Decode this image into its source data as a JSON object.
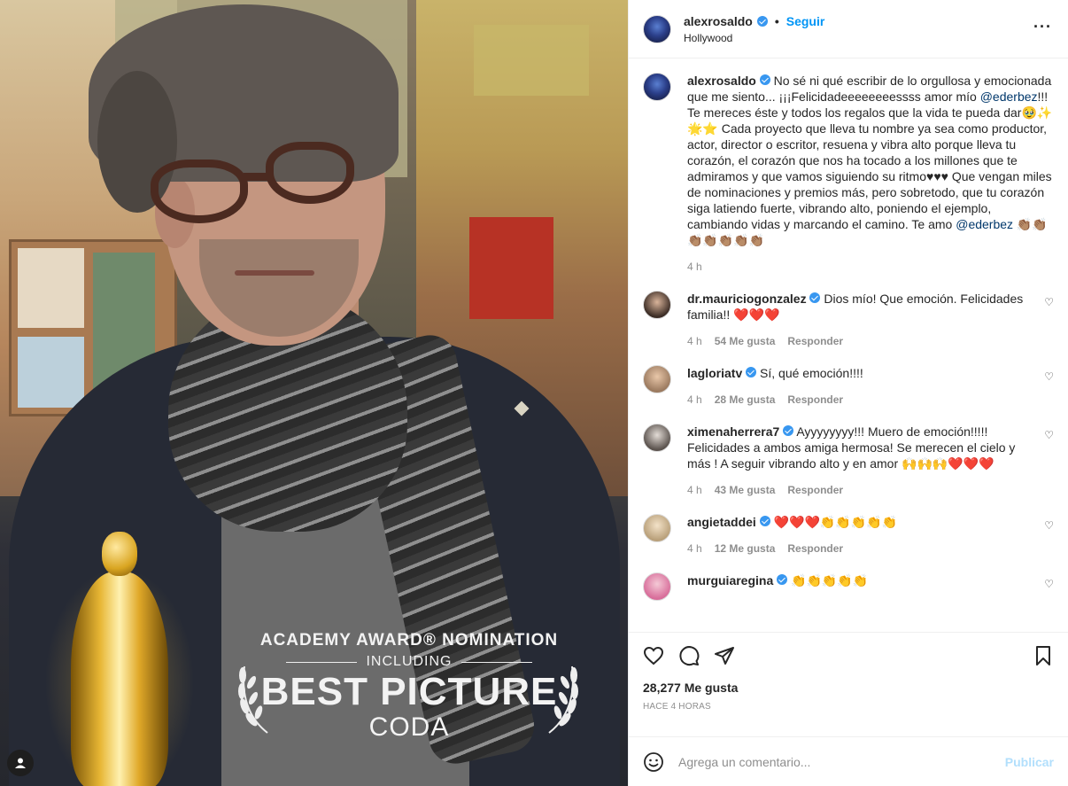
{
  "post": {
    "author": "alexrosaldo",
    "follow_separator": "•",
    "follow_label": "Seguir",
    "location": "Hollywood",
    "more_label": "···"
  },
  "media": {
    "award_line1": "ACADEMY AWARD® NOMINATION",
    "award_line2": "INCLUDING",
    "award_line3": "BEST PICTURE",
    "award_line4": "CODA"
  },
  "caption": {
    "username": "alexrosaldo",
    "text_part1": "No sé ni qué escribir de lo orgullosa y emocionada que me siento... ¡¡¡Felicidadeeeeeeeessss amor mío ",
    "mention1": "@ederbez",
    "text_part2": "!!! Te mereces éste y todos los regalos que la vida te pueda dar🥹✨🌟⭐ Cada proyecto que lleva tu nombre ya sea como productor, actor, director o escritor, resuena y vibra alto porque lleva tu corazón, el corazón que nos ha tocado a los millones que te admiramos y que vamos siguiendo su ritmo♥♥♥ Que vengan miles de nominaciones y premios más, pero sobretodo, que tu corazón siga latiendo fuerte, vibrando alto, poniendo el ejemplo, cambiando vidas y marcando el camino. Te amo ",
    "mention2": "@ederbez",
    "text_part3": " 👏🏽👏🏽👏🏽👏🏽👏🏽👏🏽👏🏽",
    "time": "4 h"
  },
  "comments": [
    {
      "username": "dr.mauriciogonzalez",
      "text": "Dios mío! Que emoción. Felicidades familia!! ❤️❤️❤️",
      "time": "4 h",
      "likes": "54 Me gusta",
      "reply": "Responder"
    },
    {
      "username": "lagloriatv",
      "text": "Sí, qué emoción!!!!",
      "time": "4 h",
      "likes": "28 Me gusta",
      "reply": "Responder"
    },
    {
      "username": "ximenaherrera7",
      "text": "Ayyyyyyyy!!! Muero de emoción!!!!! Felicidades a ambos amiga hermosa! Se merecen el cielo y más ! A seguir vibrando alto y en amor 🙌🙌🙌❤️❤️❤️",
      "time": "4 h",
      "likes": "43 Me gusta",
      "reply": "Responder"
    },
    {
      "username": "angietaddei",
      "text": "❤️❤️❤️👏👏👏👏👏",
      "time": "4 h",
      "likes": "12 Me gusta",
      "reply": "Responder"
    },
    {
      "username": "murguiaregina",
      "text": "👏👏👏👏👏"
    }
  ],
  "footer": {
    "likes": "28,277 Me gusta",
    "time_ago": "HACE 4 HORAS",
    "comment_placeholder": "Agrega un comentario...",
    "publish_label": "Publicar"
  },
  "colors": {
    "link_blue": "#0095f6",
    "verified_blue": "#3897f0",
    "muted": "#8e8e8e"
  }
}
